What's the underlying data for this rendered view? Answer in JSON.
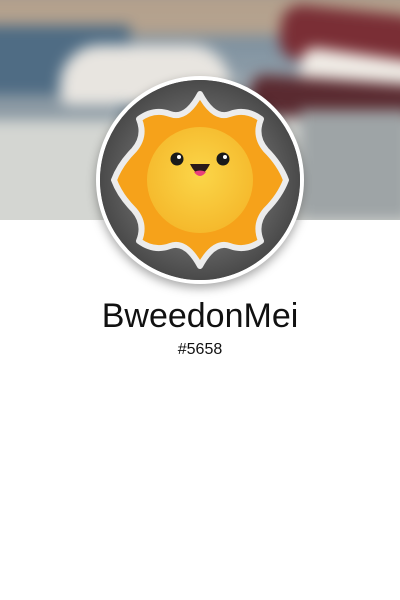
{
  "profile": {
    "username": "BweedonMei",
    "discriminator": "#5658"
  },
  "banner": {
    "description_icon": "blurred-photo-banner"
  },
  "avatar": {
    "icon": "smiling-sun-icon",
    "colors": {
      "sun_outer": "#f6a21a",
      "sun_face": "#f7c73a",
      "ray_outline": "#e8e8e8",
      "background": "#5e5e5e",
      "cheek_mouth": "#e9407a"
    }
  }
}
